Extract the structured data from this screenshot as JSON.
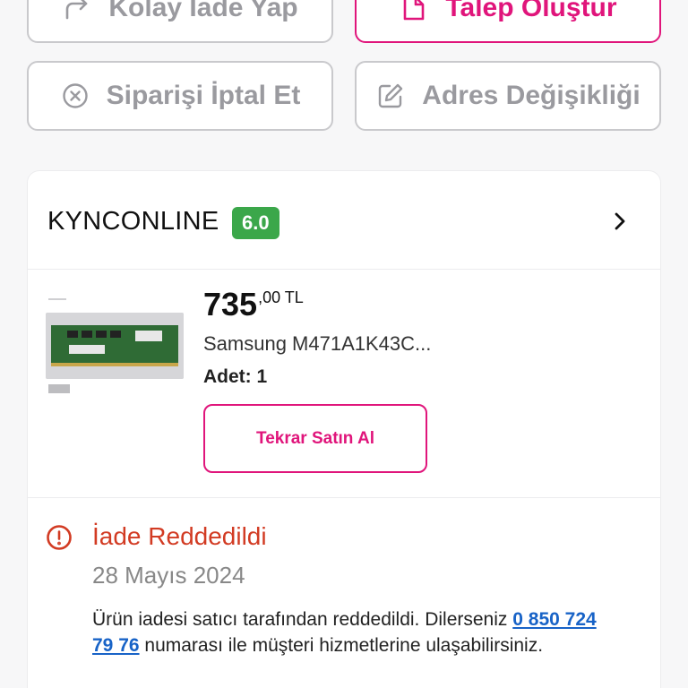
{
  "actions": {
    "return_label": "Kolay İade Yap",
    "request_label": "Talep Oluştur",
    "cancel_label": "Siparişi İptal Et",
    "address_label": "Adres Değişikliği"
  },
  "seller": {
    "name": "KYNCONLINE",
    "rating": "6.0",
    "rating_color": "#3ba74a"
  },
  "product": {
    "price_int": "735",
    "price_dec": ",00 TL",
    "name": "Samsung M471A1K43C...",
    "quantity": "Adet: 1",
    "rebuy_label": "Tekrar Satın Al"
  },
  "status": {
    "title": "İade Reddedildi",
    "date": "28 Mayıs 2024",
    "text_before": "Ürün iadesi satıcı tarafından reddedildi. Dilerseniz ",
    "phone": "0 850 724 79 76",
    "text_after": " numarası ile müşteri hizmetlerine ulaşabilirsiniz.",
    "color": "#d23b23"
  },
  "colors": {
    "accent": "#e0157b",
    "link": "#1863c7"
  },
  "icons": {
    "return": "share-arrow-icon",
    "request": "document-icon",
    "cancel": "circle-x-icon",
    "address": "edit-pencil-icon",
    "seller_chevron": "chevron-right-icon",
    "status": "alert-circle-icon"
  }
}
